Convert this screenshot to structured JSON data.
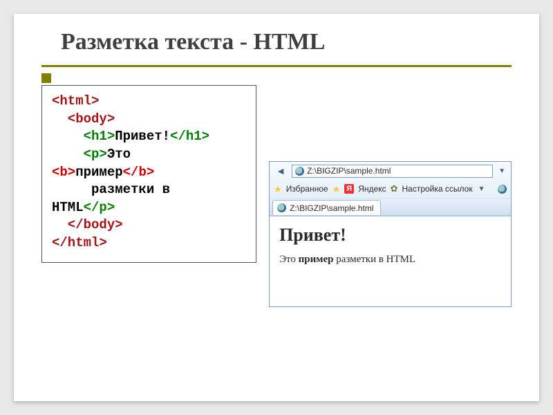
{
  "title": "Разметка текста - HTML",
  "code": {
    "l1_open": "<html>",
    "l2_open": "  <body>",
    "l3_h1o": "    <h1>",
    "l3_txt": "Привет!",
    "l3_h1c": "</h1>",
    "l4_po": "    <p>",
    "l4_txt": "Это",
    "l5_bo": "<b>",
    "l5_txt": "пример",
    "l5_bc": "</b>",
    "l6_txt": "     разметки в",
    "l7_txt": "HTML",
    "l7_pc": "</p>",
    "l8_bodyc": "  </body>",
    "l9_htmlc": "</html>"
  },
  "browser": {
    "address": "Z:\\BIGZIP\\sample.html",
    "fav_label": "Избранное",
    "yandex_label": "Яндекс",
    "settings_label": "Настройка ссылок",
    "tab_label": "Z:\\BIGZIP\\sample.html",
    "ya_char": "Я"
  },
  "rendered": {
    "heading": "Привет!",
    "p_before": "Это ",
    "p_bold": "пример",
    "p_after": " разметки в HTML"
  }
}
